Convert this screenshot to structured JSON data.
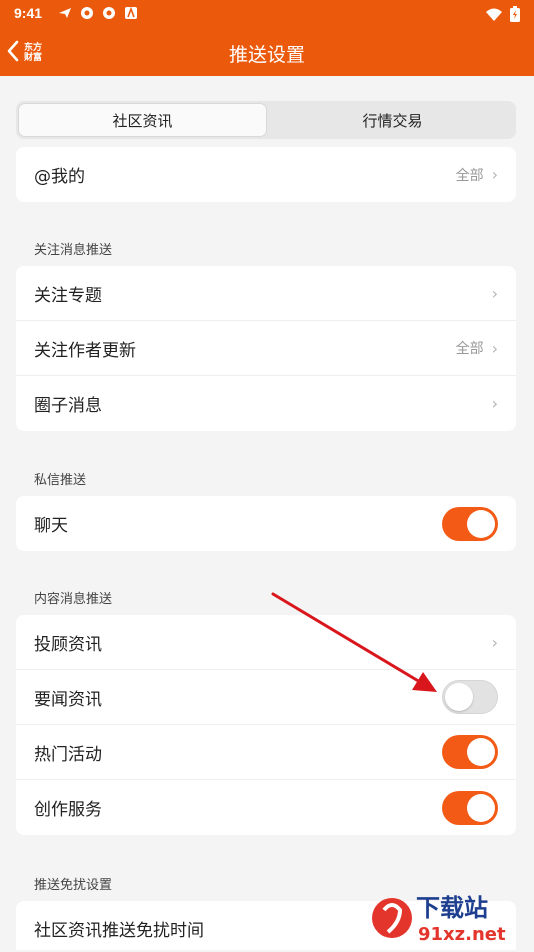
{
  "status_bar": {
    "time": "9:41"
  },
  "nav": {
    "title": "推送设置",
    "brand_line1": "东方",
    "brand_line2": "财富"
  },
  "tabs": [
    {
      "label": "社区资讯",
      "active": true
    },
    {
      "label": "行情交易",
      "active": false
    }
  ],
  "mine": {
    "label": "@我的",
    "value": "全部"
  },
  "sections": {
    "follow": {
      "header": "关注消息推送",
      "items": [
        {
          "label": "关注专题",
          "value": ""
        },
        {
          "label": "关注作者更新",
          "value": "全部"
        },
        {
          "label": "圈子消息",
          "value": ""
        }
      ]
    },
    "private": {
      "header": "私信推送",
      "items": [
        {
          "label": "聊天",
          "toggle": "on"
        }
      ]
    },
    "content": {
      "header": "内容消息推送",
      "items": [
        {
          "label": "投顾资讯",
          "type": "link"
        },
        {
          "label": "要闻资讯",
          "toggle": "off"
        },
        {
          "label": "热门活动",
          "toggle": "on"
        },
        {
          "label": "创作服务",
          "toggle": "on"
        }
      ]
    },
    "dnd": {
      "header": "推送免扰设置",
      "items": [
        {
          "label": "社区资讯推送免扰时间"
        }
      ]
    }
  },
  "watermark": {
    "text_top": "下载站",
    "text_bottom": "91xz.net"
  },
  "colors": {
    "brand": "#eb5a0c",
    "toggle_on": "#f25a15",
    "arrow": "#d9161c"
  }
}
